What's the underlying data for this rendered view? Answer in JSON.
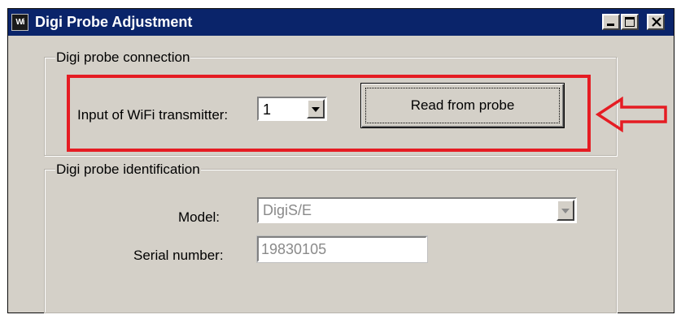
{
  "window": {
    "title": "Digi Probe Adjustment",
    "icon_text": "Wi",
    "icon": "wifi-app-icon",
    "controls": [
      "minimize-icon",
      "maximize-icon",
      "close-icon"
    ]
  },
  "connection_group": {
    "legend": "Digi probe connection",
    "input_label": "Input of WiFi transmitter:",
    "input_value": "1",
    "read_button_label": "Read from probe"
  },
  "identification_group": {
    "legend": "Digi probe identification",
    "model_label": "Model:",
    "model_value": "DigiS/E",
    "serial_label": "Serial number:",
    "serial_value": "19830105"
  },
  "annotation": {
    "highlight_color": "#e51c23",
    "arrow_icon": "left-arrow-icon"
  },
  "colors": {
    "titlebar": "#0a246a",
    "window_face": "#d4d0c8"
  }
}
